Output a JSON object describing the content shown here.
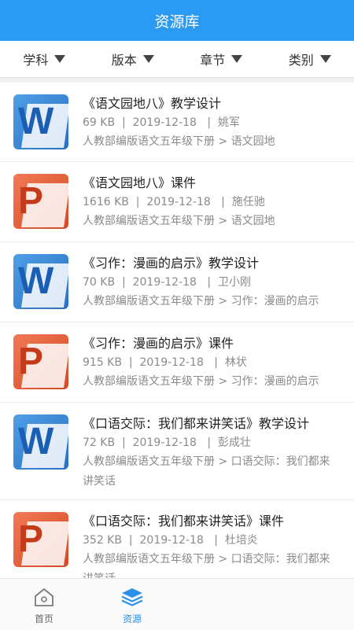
{
  "header": {
    "title": "资源库"
  },
  "filters": [
    {
      "label": "学科"
    },
    {
      "label": "版本"
    },
    {
      "label": "章节"
    },
    {
      "label": "类别"
    }
  ],
  "items": [
    {
      "type": "word",
      "icon_letter": "W",
      "title": "《语文园地八》教学设计",
      "size": "69 KB",
      "date": "2019-12-18",
      "author": "姚军",
      "path": "人教部编版语文五年级下册 > 语文园地"
    },
    {
      "type": "ppt",
      "icon_letter": "P",
      "title": "《语文园地八》课件",
      "size": "1616 KB",
      "date": "2019-12-18",
      "author": "施任驰",
      "path": "人教部编版语文五年级下册 > 语文园地"
    },
    {
      "type": "word",
      "icon_letter": "W",
      "title": "《习作：漫画的启示》教学设计",
      "size": "70 KB",
      "date": "2019-12-18",
      "author": "卫小刚",
      "path": "人教部编版语文五年级下册 > 习作：漫画的启示"
    },
    {
      "type": "ppt",
      "icon_letter": "P",
      "title": "《习作：漫画的启示》课件",
      "size": "915 KB",
      "date": "2019-12-18",
      "author": "林状",
      "path": "人教部编版语文五年级下册 > 习作：漫画的启示"
    },
    {
      "type": "word",
      "icon_letter": "W",
      "title": "《口语交际：我们都来讲笑话》教学设计",
      "size": "72 KB",
      "date": "2019-12-18",
      "author": "彭成壮",
      "path": "人教部编版语文五年级下册 > 口语交际：我们都来讲笑话"
    },
    {
      "type": "ppt",
      "icon_letter": "P",
      "title": "《口语交际：我们都来讲笑话》课件",
      "size": "352 KB",
      "date": "2019-12-18",
      "author": "杜培炎",
      "path": "人教部编版语文五年级下册 > 口语交际：我们都来讲笑话"
    }
  ],
  "meta_separator": "|",
  "tabbar": {
    "home": {
      "label": "首页",
      "icon": "home-icon"
    },
    "resources": {
      "label": "资源",
      "icon": "layers-icon"
    }
  },
  "colors": {
    "accent": "#2b9af3",
    "word": "#2a6fc2",
    "ppt": "#d24a25",
    "active_tab": "#2b8fe8"
  }
}
